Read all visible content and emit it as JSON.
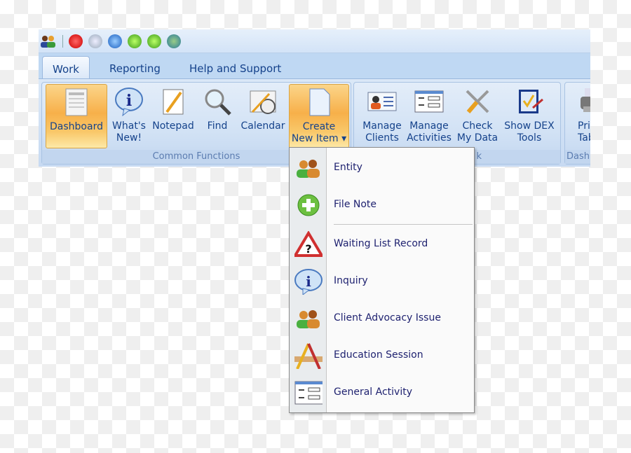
{
  "quick_access": {
    "icons": [
      "users-icon",
      "power-icon",
      "refresh-icon",
      "globe-icon",
      "down-arrow-icon",
      "up-arrow-icon",
      "sync-globe-icon"
    ]
  },
  "tabs": [
    {
      "label": "Work",
      "active": true
    },
    {
      "label": "Reporting"
    },
    {
      "label": "Help and Support"
    }
  ],
  "groups": [
    {
      "label": "Common Functions",
      "buttons": [
        {
          "l1": "Dashboard",
          "l2": ""
        },
        {
          "l1": "What's",
          "l2": "New!"
        },
        {
          "l1": "Notepad",
          "l2": ""
        },
        {
          "l1": "Find",
          "l2": ""
        },
        {
          "l1": "Calendar",
          "l2": ""
        },
        {
          "l1": "Create",
          "l2": "New Item ▾"
        }
      ]
    },
    {
      "label": "k",
      "buttons": [
        {
          "l1": "Manage",
          "l2": "Clients"
        },
        {
          "l1": "Manage",
          "l2": "Activities"
        },
        {
          "l1": "Check",
          "l2": "My Data"
        },
        {
          "l1": "Show DEX",
          "l2": "Tools"
        }
      ]
    },
    {
      "label": "Dash",
      "buttons": [
        {
          "l1": "Pri",
          "l2": "Tab"
        }
      ]
    }
  ],
  "menu": {
    "items": [
      {
        "label": "Entity",
        "icon": "people-icon"
      },
      {
        "label": "File Note",
        "icon": "plus-circle-icon"
      },
      {
        "label": "Waiting List Record",
        "icon": "warning-question-icon"
      },
      {
        "label": "Inquiry",
        "icon": "info-bubble-icon"
      },
      {
        "label": "Client Advocacy Issue",
        "icon": "people-icon"
      },
      {
        "label": "Education Session",
        "icon": "drafting-tools-icon"
      },
      {
        "label": "General Activity",
        "icon": "form-icon"
      }
    ]
  },
  "colors": {
    "highlight": "#f7b04a",
    "text": "#15428b",
    "menu_text": "#1f2270"
  }
}
